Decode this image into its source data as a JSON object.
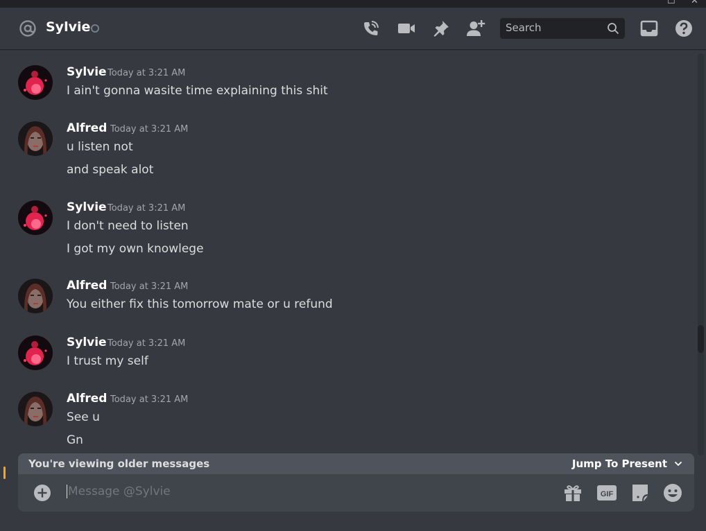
{
  "window": {
    "maximize": "☐",
    "close": "✕"
  },
  "header": {
    "channel_name": "Sylvie",
    "search_placeholder": "Search"
  },
  "messages": [
    {
      "author": "Sylvie",
      "timestamp": "Today at 3:21 AM",
      "avatar": "sylvie-avatar",
      "lines": [
        "I ain't gonna wasite time explaining this shit"
      ]
    },
    {
      "author": "Alfred",
      "timestamp": "Today at 3:21 AM",
      "avatar": "alfred-avatar",
      "lines": [
        "u listen not",
        "and speak alot"
      ]
    },
    {
      "author": "Sylvie",
      "timestamp": "Today at 3:21 AM",
      "avatar": "sylvie-avatar",
      "lines": [
        "I don't need to listen",
        "I got my own knowlege"
      ]
    },
    {
      "author": "Alfred",
      "timestamp": "Today at 3:21 AM",
      "avatar": "alfred-avatar",
      "lines": [
        "You either fix this tomorrow mate or u refund"
      ]
    },
    {
      "author": "Sylvie",
      "timestamp": "Today at 3:21 AM",
      "avatar": "sylvie-avatar",
      "lines": [
        "I trust my self"
      ]
    },
    {
      "author": "Alfred",
      "timestamp": "Today at 3:21 AM",
      "avatar": "alfred-avatar",
      "lines": [
        "See u",
        "Gn"
      ]
    }
  ],
  "older_bar": {
    "text": "You're viewing older messages",
    "jump_label": "Jump To Present"
  },
  "composer": {
    "placeholder": "Message @Sylvie",
    "gif_label": "GIF"
  },
  "colors": {
    "background": "#36393f",
    "composer": "#40444b",
    "older_bar": "#4f545c",
    "unread_indicator": "#faa61a"
  }
}
